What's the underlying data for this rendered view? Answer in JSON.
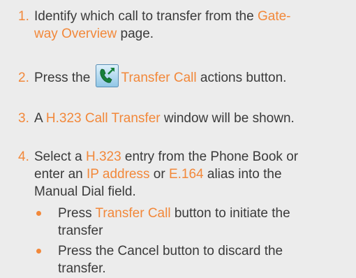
{
  "steps": [
    {
      "number": "1.",
      "text_a": "Identify which call to transfer from the ",
      "link_a": "Gate-",
      "link_b": "way Overview",
      "text_b": " page."
    },
    {
      "number": "2.",
      "text_a": "Press the ",
      "icon": "transfer-call-icon",
      "link": "Transfer Call",
      "text_b": " actions button."
    },
    {
      "number": "3.",
      "text_a": "A ",
      "link": "H.323 Call Transfer",
      "text_b": " window will be shown."
    },
    {
      "number": "4.",
      "text_a": "Select a ",
      "link_a": "H.323",
      "text_b": " entry from the Phone Book or",
      "text_c": "enter an ",
      "link_b": "IP address",
      "text_d": " or ",
      "link_c": "E.164",
      "text_e": " alias into the",
      "text_f": "Manual Dial field."
    }
  ],
  "bullets": [
    {
      "text_a": "Press ",
      "link": "Transfer Call",
      "text_b": " button to initiate the",
      "text_c": "transfer"
    },
    {
      "text_a": "Press the Cancel button to discard the",
      "text_b": "transfer."
    }
  ],
  "colors": {
    "accent": "#f2883a",
    "text": "#3a3a3a",
    "background": "#ececec"
  }
}
